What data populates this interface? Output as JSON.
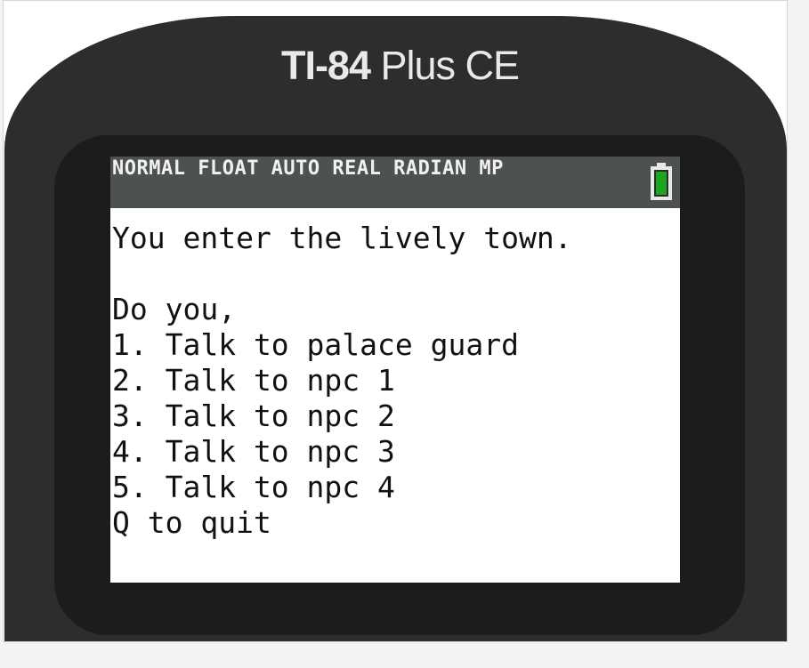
{
  "calculator": {
    "model": "TI-84",
    "variant": " Plus CE"
  },
  "status_bar": {
    "text": "NORMAL FLOAT AUTO REAL RADIAN MP",
    "battery_icon": "battery-full-icon",
    "battery_color": "#1ea51e"
  },
  "screen_lines": [
    "You enter the lively town.",
    "",
    "Do you,",
    "1. Talk to palace guard",
    "2. Talk to npc 1",
    "3. Talk to npc 2",
    "4. Talk to npc 3",
    "5. Talk to npc 4",
    "Q to quit"
  ],
  "colors": {
    "background": "#f2f3f3",
    "calculator_body": "#2c2d2d",
    "bezel": "#1c1c1c",
    "status_bar": "#4d5250",
    "screen": "#ffffff"
  }
}
